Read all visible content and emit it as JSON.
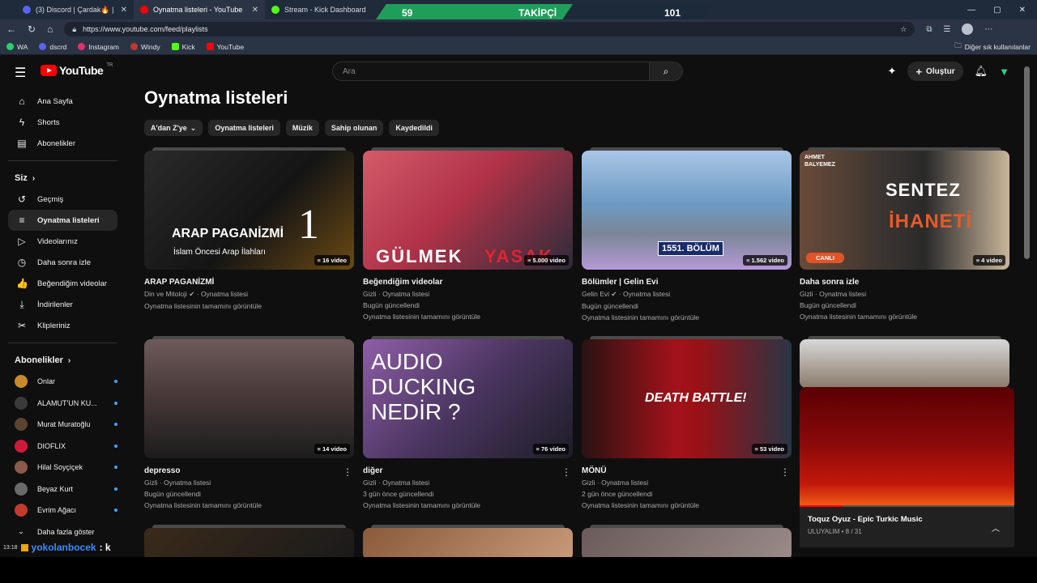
{
  "browser": {
    "tabs": [
      {
        "label": "(3) Discord | Çardak🔥 | Seli",
        "fav": "#5865f2"
      },
      {
        "label": "Oynatma listeleri - YouTube",
        "fav": "#ff0000"
      },
      {
        "label": "Stream - Kick Dashboard",
        "fav": "#53fc18"
      }
    ],
    "overlay_left_value": "59",
    "overlay_label": "TAKİPÇİ",
    "overlay_right_value": "101",
    "url": "https://www.youtube.com/feed/playlists",
    "bookmarks": [
      "WA",
      "dscrd",
      "Instagram",
      "Windy",
      "Kick",
      "YouTube"
    ],
    "other_bookmarks": "Diğer sık kullanılanlar"
  },
  "masthead": {
    "logo_text": "YouTube",
    "logo_region": "TR",
    "search_placeholder": "Ara",
    "create_label": "Oluştur"
  },
  "sidebar": {
    "top": [
      {
        "label": "Ana Sayfa",
        "icon": "⌂"
      },
      {
        "label": "Shorts",
        "icon": "ϟ"
      },
      {
        "label": "Abonelikler",
        "icon": "▤"
      }
    ],
    "you_header": "Siz",
    "you": [
      {
        "label": "Geçmiş",
        "icon": "↺"
      },
      {
        "label": "Oynatma listeleri",
        "icon": "≡"
      },
      {
        "label": "Videolarınız",
        "icon": "▷"
      },
      {
        "label": "Daha sonra izle",
        "icon": "◷"
      },
      {
        "label": "Beğendiğim videolar",
        "icon": "👍"
      },
      {
        "label": "İndirilenler",
        "icon": "⤓"
      },
      {
        "label": "Klipleriniz",
        "icon": "✂"
      }
    ],
    "subs_header": "Abonelikler",
    "subs": [
      {
        "label": "Onlar",
        "color": "#c98a2b"
      },
      {
        "label": "ALAMUT'UN KU...",
        "color": "#3a3a3a"
      },
      {
        "label": "Murat Muratoğlu",
        "color": "#5b4330"
      },
      {
        "label": "DIOFLIX",
        "color": "#d1193a"
      },
      {
        "label": "Hilal Soyçiçek",
        "color": "#8a5a4a"
      },
      {
        "label": "Beyaz Kurt",
        "color": "#6a6a6a"
      },
      {
        "label": "Evrim Ağacı",
        "color": "#c43a2a"
      }
    ],
    "more": "Daha fazla göster"
  },
  "main": {
    "title": "Oynatma listeleri",
    "chips": [
      "A'dan Z'ye",
      "Oynatma listeleri",
      "Müzik",
      "Sahip olunan",
      "Kaydedildi"
    ],
    "cards": [
      {
        "title": "ARAP PAGANİZMİ",
        "meta": "Din ve Mitoloji ✔ · Oynatma listesi",
        "meta2": "",
        "link": "Oynatma listesinin tamamını görüntüle",
        "count": "16 video",
        "bg": "linear-gradient(135deg,#2a2a2a 0%,#141414 55%,#6b4a13 100%)"
      },
      {
        "title": "Beğendiğim videolar",
        "meta": "Gizli · Oynatma listesi",
        "meta2": "Bugün güncellendi",
        "link": "Oynatma listesinin tamamını görüntüle",
        "count": "5.000 video",
        "bg": "linear-gradient(135deg,#d45b6a 0%,#b03248 45%,#2c2c3a 100%)"
      },
      {
        "title": "Bölümler | Gelin Evi",
        "meta": "Gelin Evi ✔ · Oynatma listesi",
        "meta2": "Bugün güncellendi",
        "link": "Oynatma listesinin tamamını görüntüle",
        "count": "1.562 video",
        "bg": "linear-gradient(180deg,#a9c6e6 0%,#6d9ac3 45%,#7a8696 70%,#b69ad8 100%)"
      },
      {
        "title": "Daha sonra izle",
        "meta": "Gizli · Oynatma listesi",
        "meta2": "Bugün güncellendi",
        "link": "Oynatma listesinin tamamını görüntüle",
        "count": "4 video",
        "bg": "linear-gradient(90deg,#6a4b3a 0%,#3a3430 40%,#2a2a2a 60%,#c9b59a 100%)"
      },
      {
        "title": "depresso",
        "meta": "Gizli · Oynatma listesi",
        "meta2": "Bugün güncellendi",
        "link": "Oynatma listesinin tamamını görüntüle",
        "count": "14 video",
        "bg": "linear-gradient(180deg,#6e5a5a 0%,#4a3a3a 45%,#1c1c1c 100%)"
      },
      {
        "title": "diğer",
        "meta": "Gizli · Oynatma listesi",
        "meta2": "3 gün önce güncellendi",
        "link": "Oynatma listesinin tamamını görüntüle",
        "count": "76 video",
        "bg": "linear-gradient(135deg,#8f5ea8 0%,#4a3560 50%,#1d1d26 100%)"
      },
      {
        "title": "MÖNÜ",
        "meta": "Gizli · Oynatma listesi",
        "meta2": "2 gün önce güncellendi",
        "link": "Oynatma listesinin tamamını görüntüle",
        "count": "53 video",
        "bg": "linear-gradient(90deg,#2a1212 0%,#a3121a 45%,#9a1115 55%,#2a3545 100%)"
      }
    ],
    "overlays": {
      "c0_big": "ARAP PAGANİZMİ",
      "c0_num": "1",
      "c0_sub": "İslam Öncesi Arap İlahları",
      "c1_big": "GÜLMEK",
      "c1_red": "YASAK",
      "c2_ep": "1551. BÖLÜM",
      "c3_top": "SENTEZ",
      "c3_red": "İHANETİ",
      "c3_badge": "CANLI",
      "c3_tag": "AHMET BALYEMEZ",
      "c5_text": "AUDIO DUCKING NEDİR ?",
      "c6_text": "DEATH BATTLE!"
    }
  },
  "miniplayer": {
    "title": "Toquz Oyuz - Epic Turkic Music",
    "sub": "ULUYALIM • 8 / 31"
  },
  "chat": {
    "time": "13:18",
    "user": "yokolanbocek",
    "text": ": k"
  }
}
